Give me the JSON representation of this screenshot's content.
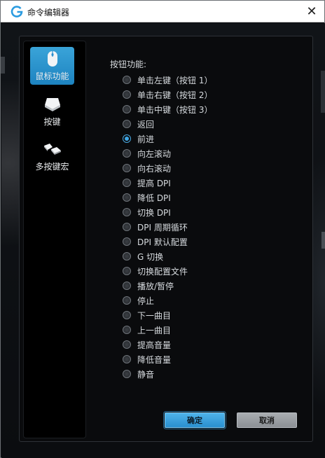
{
  "window": {
    "title": "命令编辑器",
    "close_glyph": "✕",
    "logo_icon": "logitech-g-icon",
    "accent_color": "#2a9be0"
  },
  "nav": {
    "items": [
      {
        "label": "鼠标功能",
        "icon": "mouse-icon",
        "active": true
      },
      {
        "label": "按键",
        "icon": "key-icon",
        "active": false
      },
      {
        "label": "多按键宏",
        "icon": "multi-key-icon",
        "active": false
      }
    ]
  },
  "options": {
    "heading": "按钮功能:",
    "selected": "前进",
    "items": [
      "单击左键（按钮 1）",
      "单击右键（按钮 2）",
      "单击中键（按钮 3）",
      "返回",
      "前进",
      "向左滚动",
      "向右滚动",
      "提高 DPI",
      "降低 DPI",
      "切换 DPI",
      "DPI 周期循环",
      "DPI 默认配置",
      "G 切换",
      "切换配置文件",
      "播放/暂停",
      "停止",
      "下一曲目",
      "上一曲目",
      "提高音量",
      "降低音量",
      "静音"
    ]
  },
  "buttons": {
    "ok": "确定",
    "cancel": "取消"
  }
}
